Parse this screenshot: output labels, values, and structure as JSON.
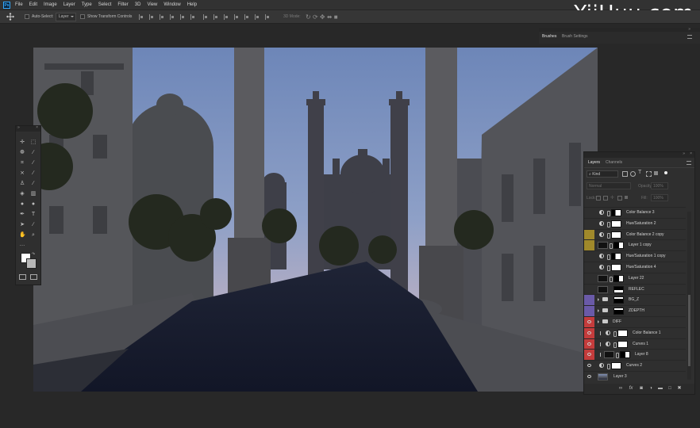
{
  "watermark": "YiiHuu.com",
  "menu": [
    "File",
    "Edit",
    "Image",
    "Layer",
    "Type",
    "Select",
    "Filter",
    "3D",
    "View",
    "Window",
    "Help"
  ],
  "options": {
    "auto_select": "Auto-Select:",
    "auto_select_value": "Layer",
    "show_transform": "Show Transform Controls",
    "mode_3d": "3D Mode:"
  },
  "top_panel": {
    "tabs": [
      "Brushes",
      "Brush Settings"
    ]
  },
  "layers_panel": {
    "tabs": [
      "Layers",
      "Channels"
    ],
    "filter_kind": "Kind",
    "blend_mode": "Normal",
    "opacity_label": "Opacity:",
    "opacity_value": "100%",
    "lock_label": "Lock:",
    "fill_label": "Fill:",
    "fill_value": "100%",
    "layers": [
      {
        "name": "Color Balance 3",
        "type": "adjustment",
        "color": "",
        "visible": false,
        "indent": 0
      },
      {
        "name": "Hue/Saturation 2",
        "type": "adjustment",
        "color": "",
        "visible": false,
        "indent": 0
      },
      {
        "name": "Color Balance 2 copy",
        "type": "adjustment",
        "color": "#a0892b",
        "visible": false,
        "indent": 0
      },
      {
        "name": "Layer 1 copy",
        "type": "pixel",
        "color": "#a0892b",
        "visible": false,
        "indent": 0
      },
      {
        "name": "Hue/Saturation 1 copy",
        "type": "adjustment",
        "color": "",
        "visible": false,
        "indent": 0
      },
      {
        "name": "Hue/Saturation 4",
        "type": "adjustment",
        "color": "",
        "visible": false,
        "indent": 0
      },
      {
        "name": "Layer 22",
        "type": "pixel",
        "color": "",
        "visible": false,
        "indent": 0
      },
      {
        "name": "REFLEC",
        "type": "pixel",
        "color": "",
        "visible": false,
        "indent": 0
      },
      {
        "name": "BG_Z",
        "type": "group",
        "color": "#6a5aa8",
        "visible": false,
        "indent": 0
      },
      {
        "name": "ZDEPTH",
        "type": "group",
        "color": "#6a5aa8",
        "visible": false,
        "indent": 0
      },
      {
        "name": "DIFF",
        "type": "group",
        "color": "#c43c3c",
        "visible": true,
        "indent": 0
      },
      {
        "name": "Color Balance 1",
        "type": "adjustment",
        "color": "#c43c3c",
        "visible": true,
        "indent": 1
      },
      {
        "name": "Curves 1",
        "type": "adjustment",
        "color": "#c43c3c",
        "visible": true,
        "indent": 1
      },
      {
        "name": "Layer 8",
        "type": "pixel",
        "color": "#c43c3c",
        "visible": true,
        "indent": 1
      },
      {
        "name": "Curves 2",
        "type": "adjustment",
        "color": "",
        "visible": true,
        "indent": 0
      },
      {
        "name": "Layer 3",
        "type": "image",
        "color": "",
        "visible": true,
        "indent": 0
      }
    ],
    "bottom_icons": [
      "link-icon",
      "fx-icon",
      "mask-icon",
      "adjustment-icon",
      "group-icon",
      "new-layer-icon",
      "trash-icon"
    ]
  }
}
